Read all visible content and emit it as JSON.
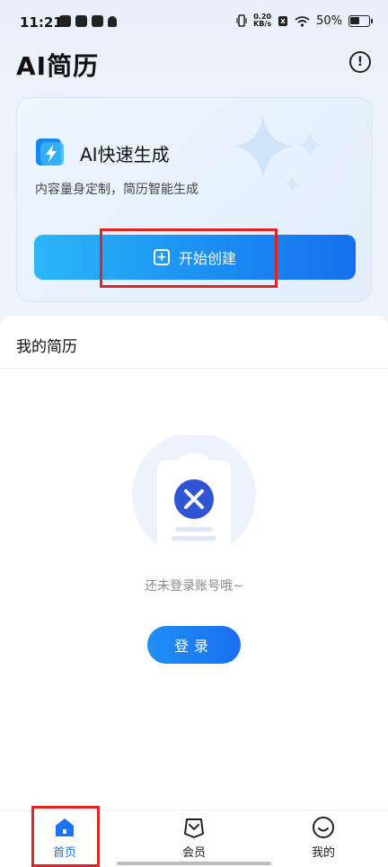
{
  "status_bar": {
    "time": "11:21",
    "net_speed_value": "0.20",
    "net_speed_unit": "KB/s",
    "battery": "50%"
  },
  "header": {
    "title": "AI简历",
    "info_icon": "info-icon"
  },
  "hero": {
    "title": "AI快速生成",
    "subtitle": "内容量身定制，简历智能生成",
    "button_label": "开始创建",
    "accent_color": "#1b8ef3"
  },
  "resumes": {
    "section_title": "我的简历",
    "empty_text": "还未登录账号哦~",
    "login_label": "登录"
  },
  "bottom_nav": {
    "items": [
      {
        "label": "首页",
        "icon": "home-icon",
        "active": true
      },
      {
        "label": "会员",
        "icon": "vip-icon",
        "active": false
      },
      {
        "label": "我的",
        "icon": "smile-icon",
        "active": false
      }
    ]
  },
  "colors": {
    "highlight": "#e02424",
    "active_nav": "#1a73f0"
  }
}
